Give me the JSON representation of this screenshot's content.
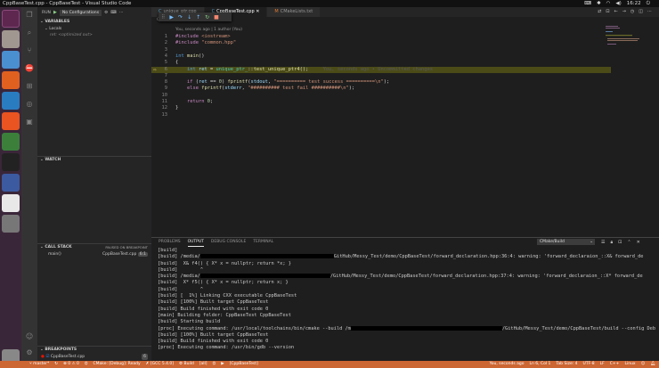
{
  "window": {
    "title": "CppBaseTest.cpp - CppBaseTest - Visual Studio Code",
    "time": "16:22"
  },
  "debug": {
    "run_label": "RUN",
    "config": "No Configurations"
  },
  "sidebar": {
    "variables_title": "VARIABLES",
    "locals_label": "Locals",
    "locals_note": "ret: <optimized out>",
    "watch_title": "WATCH",
    "callstack_title": "CALL STACK",
    "callstack_status": "PAUSED ON BREAKPOINT",
    "frame_fn": "main()",
    "frame_file": "CppBaseTest.cpp",
    "frame_line": "6:1",
    "breakpoints_title": "BREAKPOINTS",
    "bp_file": "CppBaseTest.cpp",
    "bp_count": "6"
  },
  "tabs": [
    {
      "label": "unique_ptr.cpp",
      "icon": "C"
    },
    {
      "label": "CppBaseTest.cpp",
      "icon": "C"
    },
    {
      "label": "CMakeLists.txt",
      "icon": "M"
    }
  ],
  "breadcrumb": {
    "file": "CppBaseTest.cpp",
    "fn": "main()"
  },
  "codelens": "You, seconds ago | 1 author (You)",
  "code": {
    "line_numbers": [
      "1",
      "2",
      "3",
      "4",
      "5",
      "6",
      "7",
      "8",
      "9",
      "10",
      "11",
      "12",
      "13"
    ],
    "inline_hint": "You, seconds ago • Uncommitted changes"
  },
  "panel": {
    "tabs": [
      "PROBLEMS",
      "OUTPUT",
      "DEBUG CONSOLE",
      "TERMINAL"
    ],
    "channel": "CMake/Build",
    "output": [
      "[build] ",
      "[build] /media/",
      "[build]  X& f4() { X* x = nullptr; return *x; }",
      "[build]        ^",
      "[build] /media/",
      "[build]  X* f5() { X* x = nullptr; return x; }",
      "[build]        ^",
      "[build] [  1%] Linking CXX executable CppBaseTest",
      "[build] [100%] Built target CppBaseTest",
      "[build] Build finished with exit code 0",
      "[main] Building folder: CppBaseTest CppBaseTest",
      "[build] Starting build",
      "[proc] Executing command: /usr/local/toolchains/bin/cmake --build /m",
      "[build] [100%] Built target CppBaseTest",
      "[build] Build finished with exit code 0",
      "[proc] Executing command: /usr/bin/gdb --version"
    ],
    "tails": {
      "1": "GitHub/Messy_Test/demo/CppBaseTest/forward_declaration.hpp:36:4: warning: 'forward_declaraion_::X& forward_de",
      "4": "/GitHub/Messy_Test/demo/CppBaseTest/forward_declaration.hpp:37:4: warning: 'forward_declaraion_::X* forward_de",
      "12": "/GitHub/Messy_Test/demo/CppBaseTest/build --config Deb"
    }
  },
  "status": {
    "branch": "master*",
    "errors": "0 ⚠ 0",
    "cmake": "CMake: [Debug]: Ready",
    "kit": "[GCC 5.4.0]",
    "build": "Build",
    "all": "[all]",
    "target": "[CppBaseTest]",
    "blame": "You, seconds ago",
    "position": "Ln 6, Col 1",
    "tab": "Tab Size: 4",
    "encoding": "UTF-8",
    "eol": "LF",
    "lang": "C++",
    "os": "Linux"
  },
  "colors": {
    "status_bar": "#cc6633",
    "launcher": "#3a2639",
    "highlight_line": "#4b4b18"
  }
}
